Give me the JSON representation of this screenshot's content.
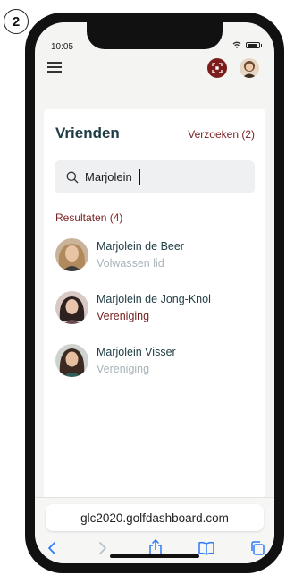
{
  "step_number": "2",
  "status": {
    "time": "10:05"
  },
  "friends": {
    "title": "Vrienden",
    "requests_link": "Verzoeken (2)"
  },
  "search": {
    "value": "Marjolein"
  },
  "results": {
    "label": "Resultaten (4)",
    "items": [
      {
        "name": "Marjolein de Beer",
        "subtitle": "Volwassen lid",
        "subtitle_style": "muted"
      },
      {
        "name": "Marjolein de Jong-Knol",
        "subtitle": "Vereniging",
        "subtitle_style": "accent"
      },
      {
        "name": "Marjolein Visser",
        "subtitle": "Vereniging",
        "subtitle_style": "muted"
      }
    ]
  },
  "browser": {
    "url": "glc2020.golfdashboard.com"
  },
  "colors": {
    "brand": "#7b1d1d",
    "title": "#1f3d44",
    "muted": "#a7b4b8",
    "ios_blue": "#2f7bf6"
  },
  "icons": [
    "menu-icon",
    "scan-icon",
    "search-icon",
    "back-icon",
    "forward-icon",
    "share-icon",
    "bookmarks-icon",
    "tabs-icon"
  ]
}
